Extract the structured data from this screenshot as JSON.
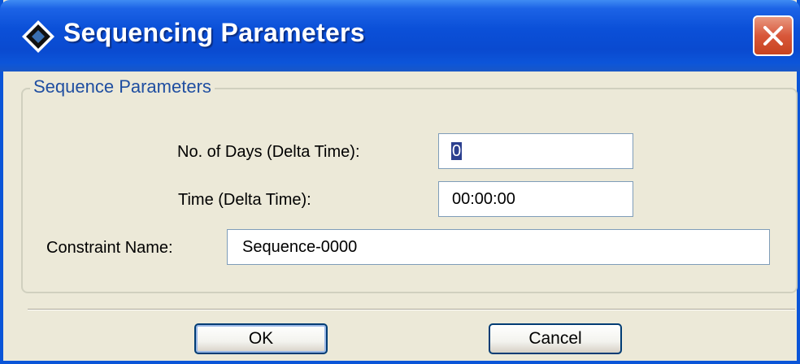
{
  "window": {
    "title": "Sequencing Parameters",
    "app_icon": "diamond-app-icon",
    "close_icon": "close-icon"
  },
  "group": {
    "legend": "Sequence Parameters"
  },
  "fields": {
    "days_label": "No. of Days (Delta Time):",
    "days_value": "0",
    "time_label": "Time (Delta Time):",
    "time_value": "00:00:00",
    "constraint_label": "Constraint Name:",
    "constraint_value": "Sequence-0000"
  },
  "buttons": {
    "ok_label": "OK",
    "cancel_label": "Cancel"
  },
  "colors": {
    "titlebar": "#0a4ad0",
    "close_button": "#d8573a",
    "legend_text": "#1f4ea1",
    "selection": "#2b3f8f"
  }
}
